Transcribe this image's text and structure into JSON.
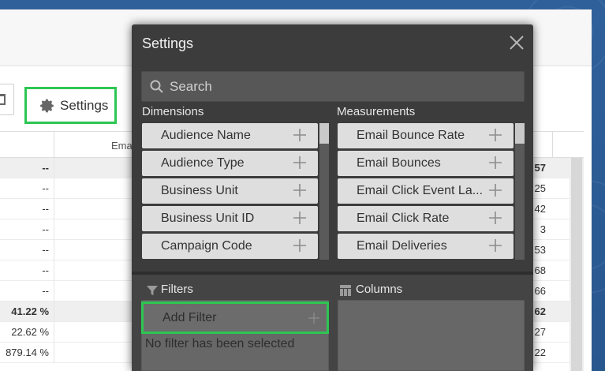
{
  "toolbar": {
    "settings_label": "Settings"
  },
  "table": {
    "header_partial": "Ema",
    "rows": [
      {
        "c1": "--",
        "c2": "57",
        "total": true
      },
      {
        "c1": "--",
        "c2": "25"
      },
      {
        "c1": "--",
        "c2": "42"
      },
      {
        "c1": "--",
        "c2": "3"
      },
      {
        "c1": "--",
        "c2": "53"
      },
      {
        "c1": "--",
        "c2": "68"
      },
      {
        "c1": "--",
        "c2": "66"
      },
      {
        "c1": "41.22 %",
        "c2": "62",
        "total": true
      },
      {
        "c1": "22.62 %",
        "c2": "27"
      },
      {
        "c1": "879.14 %",
        "c2": "22"
      }
    ]
  },
  "modal": {
    "title": "Settings",
    "search_placeholder": "Search",
    "dimensions_label": "Dimensions",
    "measurements_label": "Measurements",
    "dimensions": [
      "Audience Name",
      "Audience Type",
      "Business Unit",
      "Business Unit ID",
      "Campaign Code"
    ],
    "measurements": [
      "Email Bounce Rate",
      "Email Bounces",
      "Email Click Event La...",
      "Email Click Rate",
      "Email Deliveries"
    ],
    "filters_label": "Filters",
    "columns_label": "Columns",
    "add_filter_label": "Add Filter",
    "no_filter_text": "No filter has been selected"
  },
  "colors": {
    "highlight": "#2dc653",
    "modal_bg": "#3c3c3c",
    "item_bg": "#dedede"
  },
  "icons": {
    "settings": "gear-icon",
    "close": "close-icon",
    "search": "search-icon",
    "add": "plus-icon",
    "filter": "funnel-icon",
    "columns": "columns-icon"
  }
}
